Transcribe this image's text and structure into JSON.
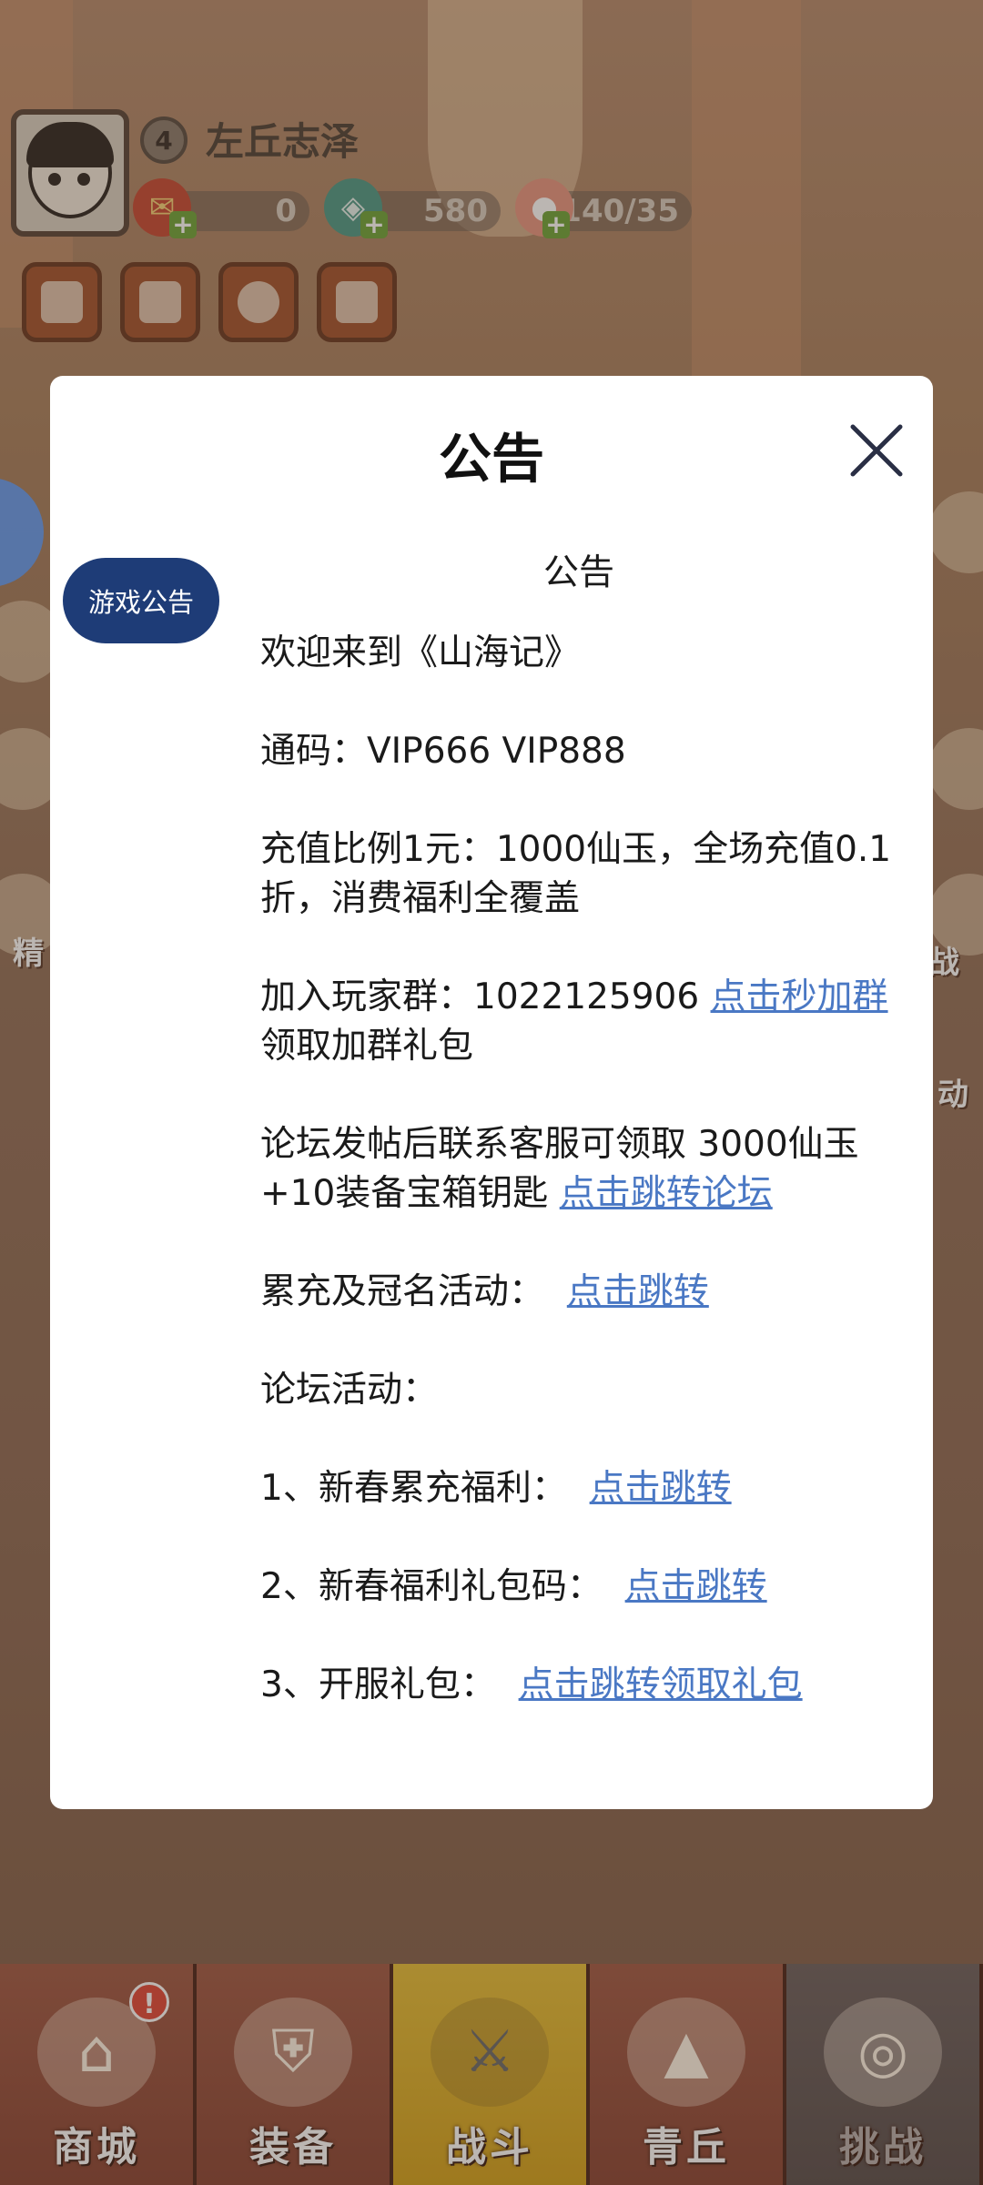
{
  "player": {
    "level": "4",
    "name": "左丘志泽"
  },
  "resources": [
    {
      "icon": "red-envelope-icon",
      "value": "0"
    },
    {
      "icon": "jade-dragon-icon",
      "value": "580"
    },
    {
      "icon": "peach-stamina-icon",
      "value": "140/35"
    }
  ],
  "menu_buttons": [
    {
      "icon": "card-icon"
    },
    {
      "icon": "rank-chart-icon"
    },
    {
      "icon": "settings-gear-icon"
    },
    {
      "icon": "friends-icon"
    }
  ],
  "side_labels": {
    "left": "精",
    "right_1": "战",
    "right_2": "动"
  },
  "modal": {
    "title": "公告",
    "tab": "游戏公告",
    "content_title": "公告",
    "lines": {
      "welcome": "欢迎来到《山海记》",
      "codes": "通码：VIP666 VIP888",
      "ratio": "充值比例1元：1000仙玉，全场充值0.1折，消费福利全覆盖",
      "group_text": "加入玩家群：1022125906 ",
      "group_link": "点击秒加群",
      "group_text2": "领取加群礼包",
      "forum_text": "论坛发帖后联系客服可领取 3000仙玉+10装备宝箱钥匙 ",
      "forum_link": "点击跳转论坛",
      "event_text": "累充及冠名活动：  ",
      "event_link": "点击跳转",
      "forum_events": "论坛活动：",
      "item1_text": "1、新春累充福利：  ",
      "item1_link": "点击跳转",
      "item2_text": "2、新春福利礼包码：  ",
      "item2_link": "点击跳转",
      "item3_text": "3、开服礼包：  ",
      "item3_link": "点击跳转领取礼包"
    }
  },
  "bottom_nav": [
    {
      "label": "商城",
      "icon": "shop-icon",
      "badge": "!"
    },
    {
      "label": "装备",
      "icon": "armor-icon"
    },
    {
      "label": "战斗",
      "icon": "crossed-swords-icon"
    },
    {
      "label": "青丘",
      "icon": "mountain-icon"
    },
    {
      "label": "挑战",
      "icon": "challenge-orb-icon"
    }
  ],
  "colors": {
    "accent_link": "#4a78c4",
    "tab_pill": "#1e3c77",
    "nav_active": "#e6bf3a"
  }
}
